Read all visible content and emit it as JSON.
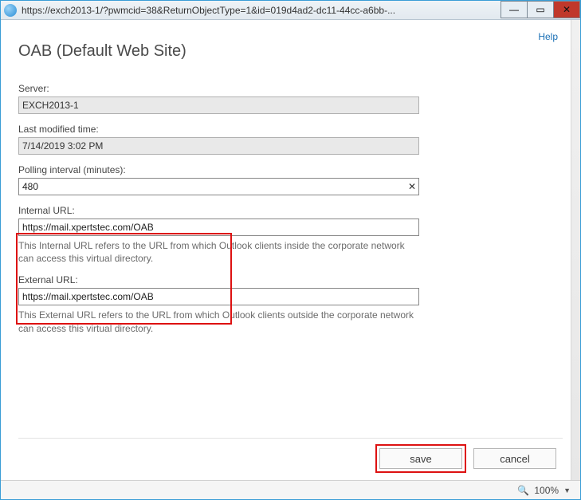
{
  "window": {
    "url": "https://exch2013-1/?pwmcid=38&ReturnObjectType=1&id=019d4ad2-dc11-44cc-a6bb-..."
  },
  "header": {
    "help": "Help",
    "title": "OAB (Default Web Site)"
  },
  "fields": {
    "server_label": "Server:",
    "server_value": "EXCH2013-1",
    "modified_label": "Last modified time:",
    "modified_value": "7/14/2019 3:02 PM",
    "polling_label": "Polling interval (minutes):",
    "polling_value": "480",
    "internal_label": "Internal URL:",
    "internal_value": "https://mail.xpertstec.com/OAB",
    "internal_help": "This Internal URL refers to the URL from which Outlook clients inside the corporate network can access this virtual directory.",
    "external_label": "External URL:",
    "external_value": "https://mail.xpertstec.com/OAB",
    "external_help": "This External URL refers to the URL from which Outlook clients outside the corporate network can access this virtual directory."
  },
  "buttons": {
    "save": "save",
    "cancel": "cancel"
  },
  "status": {
    "zoom": "100%"
  }
}
